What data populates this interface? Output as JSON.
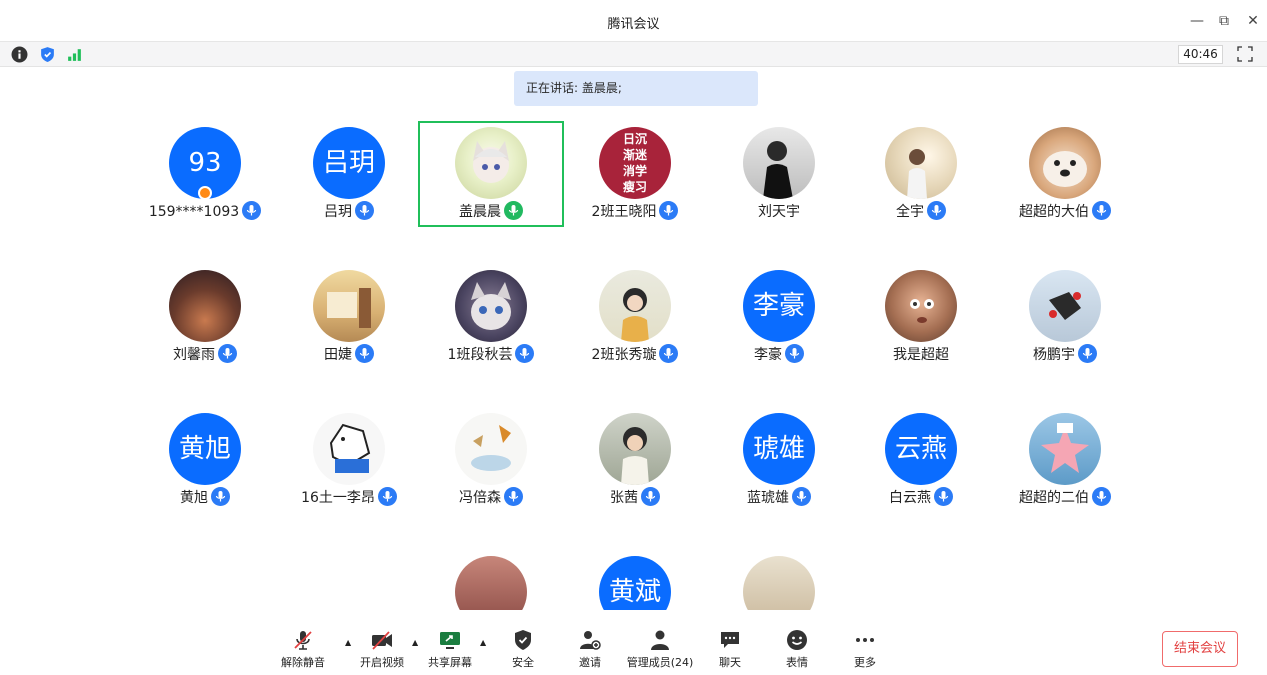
{
  "window": {
    "title": "腾讯会议",
    "minimize": "—",
    "restore": "⧉",
    "close": "✕"
  },
  "toolbar": {
    "timer": "40:46"
  },
  "speaking_banner": "正在讲话: 盖晨晨;",
  "participants": [
    {
      "name": "159****1093",
      "avatar_text": "93"
    },
    {
      "name": "吕玥",
      "avatar_text": "吕玥"
    },
    {
      "name": "盖晨晨",
      "avatar_text": ""
    },
    {
      "name": "2班王晓阳",
      "avatar_text": "日沉\n渐迷\n消学\n瘦习"
    },
    {
      "name": "刘天宇",
      "avatar_text": ""
    },
    {
      "name": "全宇",
      "avatar_text": ""
    },
    {
      "name": "超超的大伯",
      "avatar_text": ""
    },
    {
      "name": "刘馨雨",
      "avatar_text": ""
    },
    {
      "name": "田婕",
      "avatar_text": ""
    },
    {
      "name": "1班段秋芸",
      "avatar_text": ""
    },
    {
      "name": "2班张秀璇",
      "avatar_text": ""
    },
    {
      "name": "李豪",
      "avatar_text": "李豪"
    },
    {
      "name": "我是超超",
      "avatar_text": ""
    },
    {
      "name": "杨鹏宇",
      "avatar_text": ""
    },
    {
      "name": "黄旭",
      "avatar_text": "黄旭"
    },
    {
      "name": "16土一李昂",
      "avatar_text": ""
    },
    {
      "name": "冯倍森",
      "avatar_text": ""
    },
    {
      "name": "张茜",
      "avatar_text": ""
    },
    {
      "name": "蓝琥雄",
      "avatar_text": "琥雄"
    },
    {
      "name": "白云燕",
      "avatar_text": "云燕"
    },
    {
      "name": "超超的二伯",
      "avatar_text": ""
    },
    {
      "name": "",
      "avatar_text": ""
    },
    {
      "name": "",
      "avatar_text": "黄斌"
    },
    {
      "name": "",
      "avatar_text": ""
    }
  ],
  "bottom_bar": {
    "unmute": "解除静音",
    "start_video": "开启视频",
    "share_screen": "共享屏幕",
    "security": "安全",
    "invite": "邀请",
    "manage_members": "管理成员(24)",
    "chat": "聊天",
    "reactions": "表情",
    "more": "更多",
    "end_meeting": "结束会议"
  },
  "colors": {
    "accent": "#0a6cff",
    "speaking": "#20bf5a",
    "end": "#e24141"
  }
}
